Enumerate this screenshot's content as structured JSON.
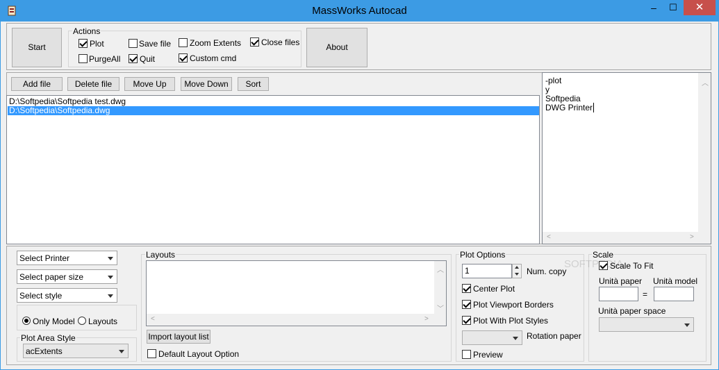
{
  "window": {
    "title": "MassWorks Autocad",
    "minimize": "–",
    "maximize": "☐",
    "close": "✕"
  },
  "top": {
    "start_label": "Start",
    "about_label": "About",
    "actions": {
      "title": "Actions",
      "plot": "Plot",
      "purgeall": "PurgeAll",
      "save_file": "Save file",
      "quit": "Quit",
      "zoom_extents": "Zoom Extents",
      "custom_cmd": "Custom cmd",
      "close_files": "Close files"
    }
  },
  "file_toolbar": {
    "add": "Add file",
    "delete": "Delete file",
    "move_up": "Move Up",
    "move_down": "Move Down",
    "sort": "Sort"
  },
  "files": [
    "D:\\Softpedia\\Softpedia test.dwg",
    "D:\\Softpedia\\Softpedia.dwg"
  ],
  "custom_cmd_lines": [
    "-plot",
    "y",
    "Softpedia",
    "DWG Printer"
  ],
  "printer": {
    "select_printer": "Select Printer",
    "select_paper_size": "Select paper size",
    "select_style": "Select style",
    "only_model": "Only Model",
    "layouts": "Layouts",
    "plot_area_style_title": "Plot Area Style",
    "plot_area_value": "acExtents"
  },
  "layouts_panel": {
    "title": "Layouts",
    "import_label": "Import layout list",
    "default_option": "Default Layout Option"
  },
  "plot_options": {
    "title": "Plot Options",
    "num_copy_value": "1",
    "num_copy_label": "Num. copy",
    "center_plot": "Center Plot",
    "viewport_borders": "Plot Viewport Borders",
    "plot_styles": "Plot With Plot Styles",
    "rotation_paper": "Rotation paper",
    "preview": "Preview"
  },
  "scale": {
    "title": "Scale",
    "scale_to_fit": "Scale To Fit",
    "unita_paper": "Unità paper",
    "equals": "=",
    "unita_model": "Unità model",
    "unita_paper_space": "Unità paper space"
  },
  "watermark": "SOFTPEDIA"
}
